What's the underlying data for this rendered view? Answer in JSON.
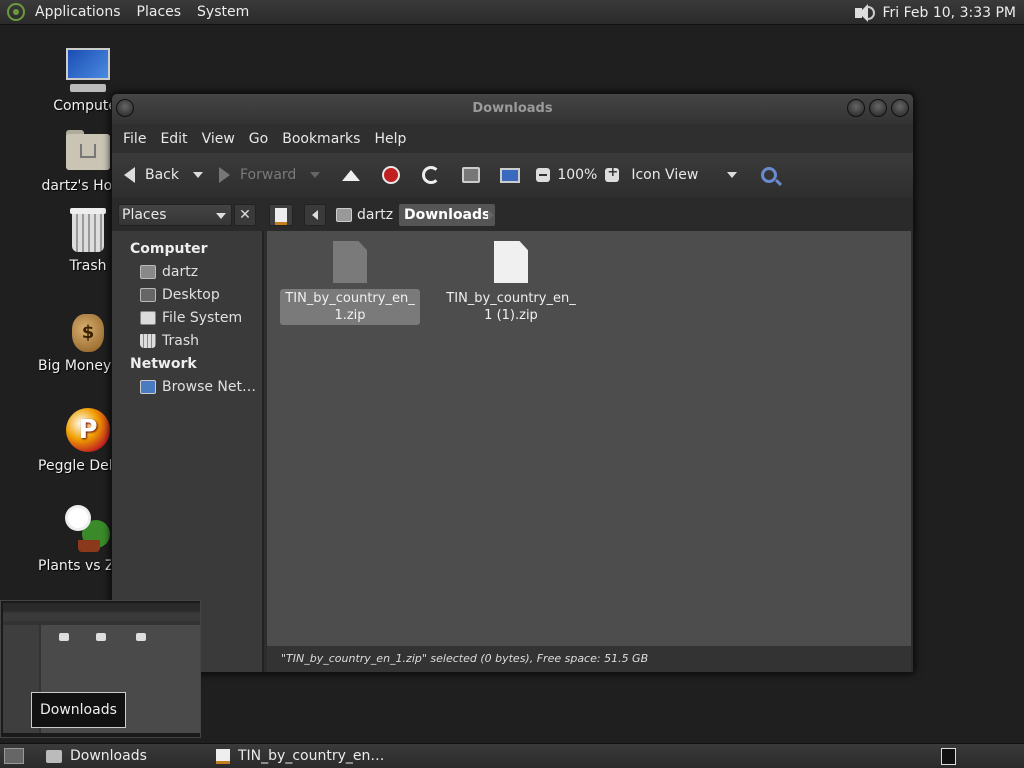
{
  "top_panel": {
    "menus": [
      "Applications",
      "Places",
      "System"
    ],
    "clock": "Fri Feb 10,  3:33 PM",
    "icons": [
      "distro-logo-icon",
      "volume-icon"
    ]
  },
  "desktop": {
    "icons": [
      {
        "label": "Computer",
        "icon": "computer-icon"
      },
      {
        "label": "dartz's Home",
        "icon": "home-folder-icon"
      },
      {
        "label": "Trash",
        "icon": "trash-icon"
      },
      {
        "label": "Big Money Deluxe",
        "icon": "money-bag-icon"
      },
      {
        "label": "Peggle Deluxe",
        "icon": "peggle-icon"
      },
      {
        "label": "Plants vs Zombies",
        "icon": "plants-icon"
      }
    ]
  },
  "window": {
    "title": "Downloads",
    "menu": [
      "File",
      "Edit",
      "View",
      "Go",
      "Bookmarks",
      "Help"
    ],
    "toolbar": {
      "back": "Back",
      "forward": "Forward",
      "zoom": "100%",
      "view_mode": "Icon View"
    },
    "location": {
      "places_combo": "Places",
      "close": "✕",
      "crumbs": [
        "dartz",
        "Downloads"
      ]
    },
    "sidebar": {
      "computer_heading": "Computer",
      "computer_items": [
        "dartz",
        "Desktop",
        "File System",
        "Trash"
      ],
      "network_heading": "Network",
      "network_items": [
        "Browse Net…"
      ]
    },
    "files": [
      {
        "name": "TIN_by_country_en_1.zip",
        "selected": true
      },
      {
        "name": "TIN_by_country_en_1 (1).zip",
        "selected": false
      }
    ],
    "status": "\"TIN_by_country_en_1.zip\" selected (0 bytes), Free space: 51.5 GB"
  },
  "thumbnail": {
    "label": "Downloads"
  },
  "taskbar": {
    "tasks": [
      "Downloads",
      "TIN_by_country_en…"
    ]
  }
}
